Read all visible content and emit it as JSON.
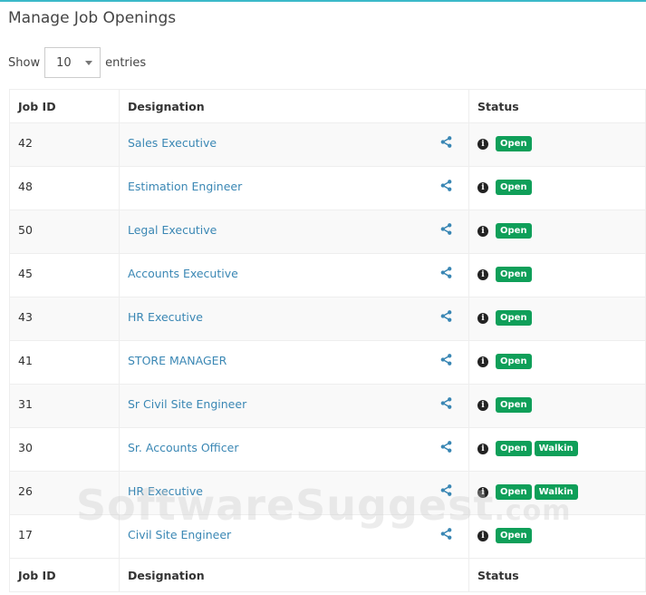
{
  "title": "Manage Job Openings",
  "length": {
    "show": "Show",
    "value": "10",
    "entries": "entries"
  },
  "columns": [
    "Job ID",
    "Designation",
    "Status"
  ],
  "rows": [
    {
      "id": "42",
      "designation": "Sales Executive",
      "badges": [
        "Open"
      ]
    },
    {
      "id": "48",
      "designation": "Estimation Engineer",
      "badges": [
        "Open"
      ]
    },
    {
      "id": "50",
      "designation": "Legal Executive",
      "badges": [
        "Open"
      ]
    },
    {
      "id": "45",
      "designation": "Accounts Executive",
      "badges": [
        "Open"
      ]
    },
    {
      "id": "43",
      "designation": "HR Executive",
      "badges": [
        "Open"
      ]
    },
    {
      "id": "41",
      "designation": "STORE MANAGER",
      "badges": [
        "Open"
      ]
    },
    {
      "id": "31",
      "designation": "Sr Civil Site Engineer",
      "badges": [
        "Open"
      ]
    },
    {
      "id": "30",
      "designation": "Sr. Accounts Officer",
      "badges": [
        "Open",
        "Walkin"
      ]
    },
    {
      "id": "26",
      "designation": "HR Executive",
      "badges": [
        "Open",
        "Walkin"
      ]
    },
    {
      "id": "17",
      "designation": "Civil Site Engineer",
      "badges": [
        "Open"
      ]
    }
  ],
  "watermark": "SoftwareSuggest.com",
  "colors": {
    "accent": "#3bb9c9",
    "badge": "#0f9f59",
    "link": "#3a87b4"
  }
}
